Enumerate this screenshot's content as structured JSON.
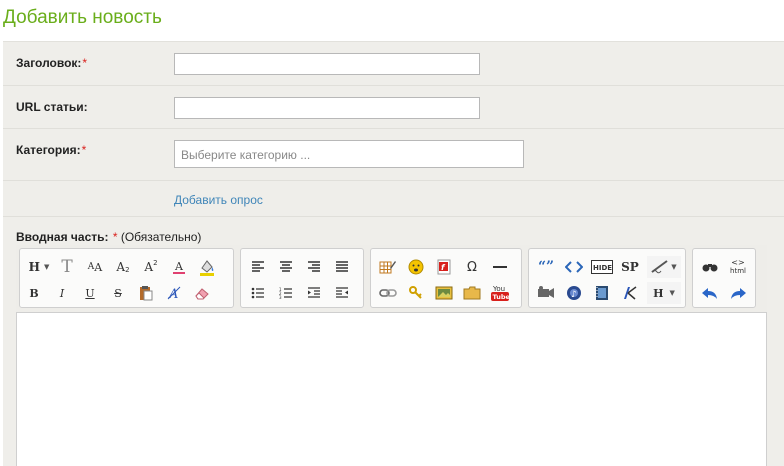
{
  "page": {
    "title": "Добавить новость"
  },
  "form": {
    "title_label": "Заголовок:",
    "title_value": "",
    "url_label": "URL статьи:",
    "url_value": "",
    "category_label": "Категория:",
    "category_placeholder": "Выберите категорию ...",
    "add_poll_link": "Добавить опрос",
    "required_mark": "*",
    "intro_label": "Вводная часть:",
    "intro_required": "*",
    "intro_note": " (Обязательно)"
  },
  "toolbar": {
    "heading_label": "H",
    "header_select_label": "H",
    "sp_label": "SP",
    "html_label": "html",
    "youtube_label": "You Tube"
  },
  "colors": {
    "title_green": "#6aae1b",
    "link_blue": "#3f85b8",
    "required_red": "#d9201c",
    "panel_bg": "#efeeea"
  }
}
